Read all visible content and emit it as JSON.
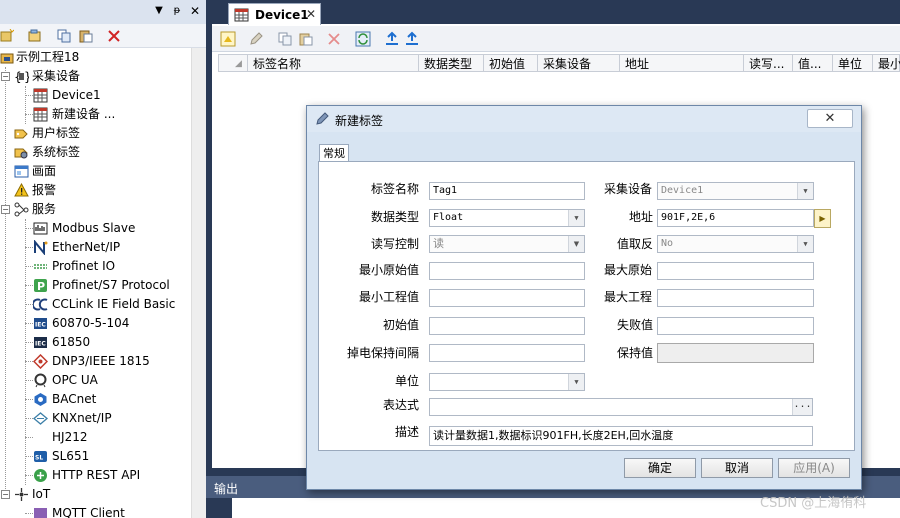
{
  "project_tree": {
    "items": [
      {
        "label": "示例工程18",
        "icon": "project-icon"
      },
      {
        "label": "采集设备",
        "icon": "acquisition-devices-icon"
      },
      {
        "label": "Device1",
        "icon": "device-icon"
      },
      {
        "label": "新建设备 ...",
        "icon": "new-device-icon"
      },
      {
        "label": "用户标签",
        "icon": "user-tags-icon"
      },
      {
        "label": "系统标签",
        "icon": "system-tags-icon"
      },
      {
        "label": "画面",
        "icon": "screen-icon"
      },
      {
        "label": "报警",
        "icon": "alarm-icon"
      },
      {
        "label": "服务",
        "icon": "services-icon"
      },
      {
        "label": "Modbus Slave",
        "icon": "modbus-icon"
      },
      {
        "label": "EtherNet/IP",
        "icon": "ethernet-ip-icon"
      },
      {
        "label": "Profinet IO",
        "icon": "profinet-icon"
      },
      {
        "label": "Profinet/S7 Protocol",
        "icon": "profinet-s7-icon"
      },
      {
        "label": "CCLink IE Field Basic",
        "icon": "cclink-icon"
      },
      {
        "label": "60870-5-104",
        "icon": "iec-104-icon"
      },
      {
        "label": "61850",
        "icon": "iec-61850-icon"
      },
      {
        "label": "DNP3/IEEE 1815",
        "icon": "dnp3-icon"
      },
      {
        "label": "OPC UA",
        "icon": "opc-ua-icon"
      },
      {
        "label": "BACnet",
        "icon": "bacnet-icon"
      },
      {
        "label": "KNXnet/IP",
        "icon": "knx-icon"
      },
      {
        "label": "HJ212",
        "icon": "hj212-icon"
      },
      {
        "label": "SL651",
        "icon": "sl651-icon"
      },
      {
        "label": "HTTP REST API",
        "icon": "http-rest-icon"
      },
      {
        "label": "IoT",
        "icon": "iot-icon"
      },
      {
        "label": "MQTT Client",
        "icon": "mqtt-icon"
      }
    ]
  },
  "document": {
    "tab_label": "Device1",
    "columns": [
      "标签名称",
      "数据类型",
      "初始值",
      "采集设备",
      "地址",
      "读写...",
      "值...",
      "单位",
      "最小"
    ]
  },
  "output": {
    "label": "输出"
  },
  "dialog": {
    "title": "新建标签",
    "close_label": "✕",
    "tab_label": "常规",
    "fields": {
      "tag_name": {
        "label": "标签名称",
        "value": "Tag1"
      },
      "acq_device": {
        "label": "采集设备",
        "value": "Device1"
      },
      "data_type": {
        "label": "数据类型",
        "value": "Float"
      },
      "address": {
        "label": "地址",
        "value": "901F,2E,6"
      },
      "rw_control": {
        "label": "读写控制",
        "value": "读"
      },
      "value_invert": {
        "label": "值取反",
        "value": "No"
      },
      "min_raw": {
        "label": "最小原始值",
        "value": ""
      },
      "max_raw": {
        "label": "最大原始",
        "value": ""
      },
      "min_eng": {
        "label": "最小工程值",
        "value": ""
      },
      "max_eng": {
        "label": "最大工程",
        "value": ""
      },
      "initial": {
        "label": "初始值",
        "value": ""
      },
      "fail_value": {
        "label": "失败值",
        "value": ""
      },
      "power_loss": {
        "label": "掉电保持间隔",
        "value": ""
      },
      "retain": {
        "label": "保持值",
        "value": ""
      },
      "unit": {
        "label": "单位",
        "value": ""
      },
      "expression": {
        "label": "表达式",
        "value": ""
      },
      "description": {
        "label": "描述",
        "value": "读计量数据1,数据标识901FH,长度2EH,回水温度"
      }
    },
    "buttons": {
      "ok": "确定",
      "cancel": "取消",
      "apply": "应用(A)"
    }
  },
  "watermark": "CSDN @上海侑科",
  "colors": {
    "frame": "#293955",
    "panel_header": "#dbe3ef",
    "dialog_bg": "#d7e4f2",
    "output_bar": "#4a5d7e"
  }
}
